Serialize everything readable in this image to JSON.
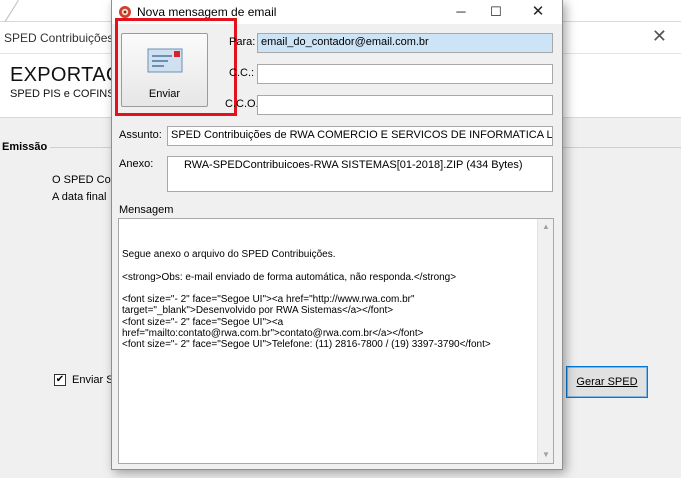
{
  "background": {
    "window_title": "SPED Contribuições",
    "heading": "EXPORTAÇÃ",
    "subheading": "SPED PIS e COFINS",
    "section_label": "Emissão",
    "line1": "O SPED Co",
    "line2": "A data final",
    "checkbox_label": "Enviar S",
    "generate_button_label": "Gerar SPED"
  },
  "dialog": {
    "title": "Nova mensagem de email",
    "send_button_label": "Enviar",
    "send_icon": "envelope-icon",
    "fields": {
      "to_label": "Para:",
      "to_value": "email_do_contador@email.com.br",
      "cc_label": "C.C.:",
      "cc_value": "",
      "cco_label": "C.C.O.:",
      "cco_value": "",
      "subject_label": "Assunto:",
      "subject_value": "SPED Contribuições de RWA COMERCIO E SERVICOS DE INFORMATICA LTDA",
      "attachment_label": "Anexo:",
      "attachment_value": "RWA-SPEDContribuicoes-RWA SISTEMAS[01-2018].ZIP (434 Bytes)",
      "message_label": "Mensagem"
    },
    "message_body": "Segue anexo o arquivo do SPED Contribuições.\n\n<strong>Obs: e-mail enviado de forma automática, não responda.</strong>\n\n<font size=\"- 2\" face=\"Segoe UI\"><a href=\"http://www.rwa.com.br\" target=\"_blank\">Desenvolvido por RWA Sistemas</a></font>\n<font size=\"- 2\" face=\"Segoe UI\"><a href=\"mailto:contato@rwa.com.br\">contato@rwa.com.br</a></font>\n<font size=\"- 2\" face=\"Segoe UI\">Telefone: (11) 2816-7800 / (19) 3397-3790</font>",
    "colors": {
      "highlight": "#e3131d",
      "selected_field": "#cde4f7"
    }
  }
}
